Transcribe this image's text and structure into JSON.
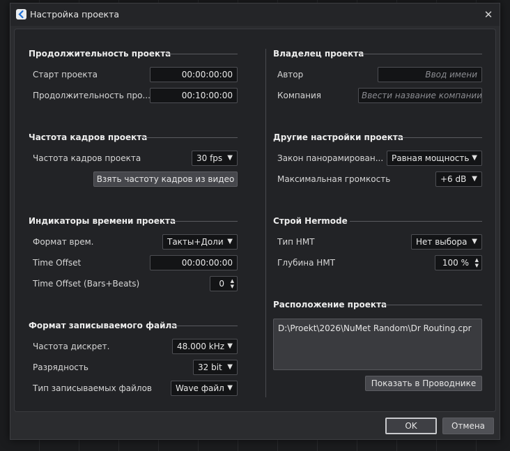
{
  "window": {
    "title": "Настройка проекта",
    "close_glyph": "✕"
  },
  "duration": {
    "section": "Продолжительность проекта",
    "start_label": "Старт проекта",
    "start_value": "00:00:00:00",
    "length_label": "Продолжительность про...",
    "length_value": "00:10:00:00"
  },
  "framerate": {
    "section": "Частота кадров проекта",
    "label": "Частота кадров проекта",
    "value": "30 fps",
    "take_button": "Взять частоту кадров из видео"
  },
  "time_indicators": {
    "section": "Индикаторы времени проекта",
    "format_label": "Формат врем.",
    "format_value": "Такты+Доли",
    "offset_label": "Time Offset",
    "offset_value": "00:00:00:00",
    "offset_bars_label": "Time Offset (Bars+Beats)",
    "offset_bars_value": "0"
  },
  "record_format": {
    "section": "Формат записываемого файла",
    "rate_label": "Частота дискрет.",
    "rate_value": "48.000 kHz",
    "bits_label": "Разрядность",
    "bits_value": "32 bit",
    "type_label": "Тип записываемых файлов",
    "type_value": "Wave файл"
  },
  "owner": {
    "section": "Владелец проекта",
    "author_label": "Автор",
    "author_placeholder": "Ввод имени",
    "company_label": "Компания",
    "company_placeholder": "Ввести название компании"
  },
  "other": {
    "section": "Другие настройки проекта",
    "pan_label": "Закон панорамирован...",
    "pan_value": "Равная мощность",
    "max_label": "Максимальная громкость",
    "max_value": "+6 dB"
  },
  "hermode": {
    "section": "Строй Hermode",
    "type_label": "Тип HMT",
    "type_value": "Нет выбора",
    "depth_label": "Глубина HMT",
    "depth_value": "100 %"
  },
  "location": {
    "section": "Расположение проекта",
    "path": "D:\\Proekt\\2026\\NuMet Random\\Dr Routing.cpr",
    "show_button": "Показать в Проводнике"
  },
  "footer": {
    "ok": "OK",
    "cancel": "Отмена"
  },
  "glyphs": {
    "dropdown_arrow": "▼",
    "spin_up": "▲",
    "spin_down": "▼"
  },
  "colors": {
    "dialog_bg": "#2b2c2f",
    "panel_bg": "#222326",
    "field_bg": "#131416"
  },
  "icons": {
    "app": "cubase-logo-icon",
    "close": "close-icon"
  }
}
